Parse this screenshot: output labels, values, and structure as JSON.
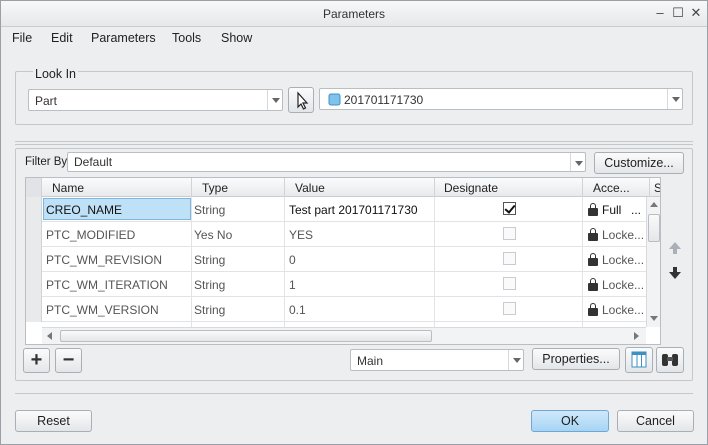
{
  "window": {
    "title": "Parameters"
  },
  "menu": [
    "File",
    "Edit",
    "Parameters",
    "Tools",
    "Show"
  ],
  "look_in": {
    "label": "Look In",
    "type_value": "Part",
    "model_value": "201701171730"
  },
  "filter": {
    "label": "Filter By",
    "value": "Default",
    "customize_label": "Customize..."
  },
  "table": {
    "columns": [
      "Name",
      "Type",
      "Value",
      "Designate",
      "Acce...",
      "S"
    ],
    "rows": [
      {
        "name": "CREO_NAME",
        "type": "String",
        "value": "Test part 201701171730",
        "designate": true,
        "access": "Full",
        "extra": "..."
      },
      {
        "name": "PTC_MODIFIED",
        "type": "Yes No",
        "value": "YES",
        "designate": false,
        "access": "Locke...",
        "extra": ""
      },
      {
        "name": "PTC_WM_REVISION",
        "type": "String",
        "value": "0",
        "designate": false,
        "access": "Locke...",
        "extra": ""
      },
      {
        "name": "PTC_WM_ITERATION",
        "type": "String",
        "value": "1",
        "designate": false,
        "access": "Locke...",
        "extra": ""
      },
      {
        "name": "PTC_WM_VERSION",
        "type": "String",
        "value": "0.1",
        "designate": false,
        "access": "Locke...",
        "extra": ""
      }
    ]
  },
  "bottom_tools": {
    "add_symbol": "+",
    "remove_symbol": "−",
    "view_value": "Main",
    "properties_label": "Properties..."
  },
  "footer": {
    "reset_label": "Reset",
    "ok_label": "OK",
    "cancel_label": "Cancel"
  },
  "icons": [
    "minimize-icon",
    "maximize-icon",
    "close-icon",
    "pointer-select-icon",
    "part-icon",
    "lock-icon",
    "move-up-icon",
    "move-down-icon",
    "table-columns-icon",
    "binoculars-icon"
  ],
  "colors": {
    "selection": "#bfe1f7",
    "ok_button": "#a7d4f4"
  }
}
